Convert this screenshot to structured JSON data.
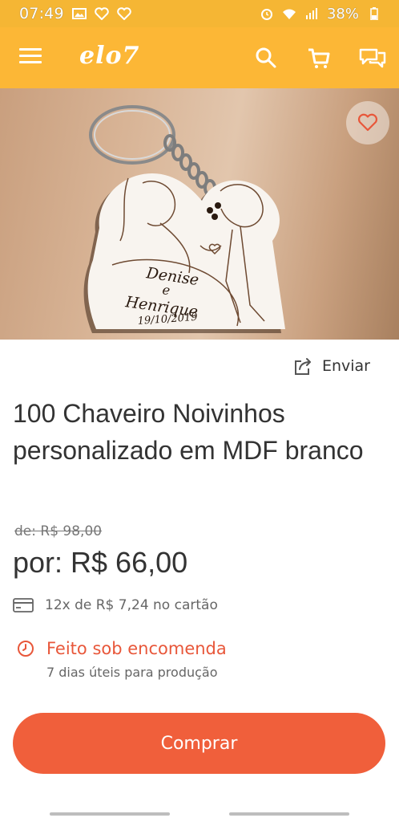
{
  "status_bar": {
    "time": "07:49",
    "battery": "38%"
  },
  "app_bar": {
    "logo": "elo7"
  },
  "product": {
    "share_label": "Enviar",
    "title": "100 Chaveiro Noivinhos personalizado em MDF branco",
    "old_price": "de: R$ 98,00",
    "price": "por: R$ 66,00",
    "installments": "12x de R$ 7,24 no cartão",
    "made_to_order_title": "Feito sob encomenda",
    "made_to_order_sub": "7 dias úteis para produção",
    "buy_label": "Comprar"
  },
  "image": {
    "engraving_name1": "Denise",
    "engraving_conj": "e",
    "engraving_name2": "Henrique",
    "engraving_date": "19/10/2019"
  },
  "colors": {
    "brand": "#fcb736",
    "accent": "#f05f3b",
    "text": "#333333"
  }
}
